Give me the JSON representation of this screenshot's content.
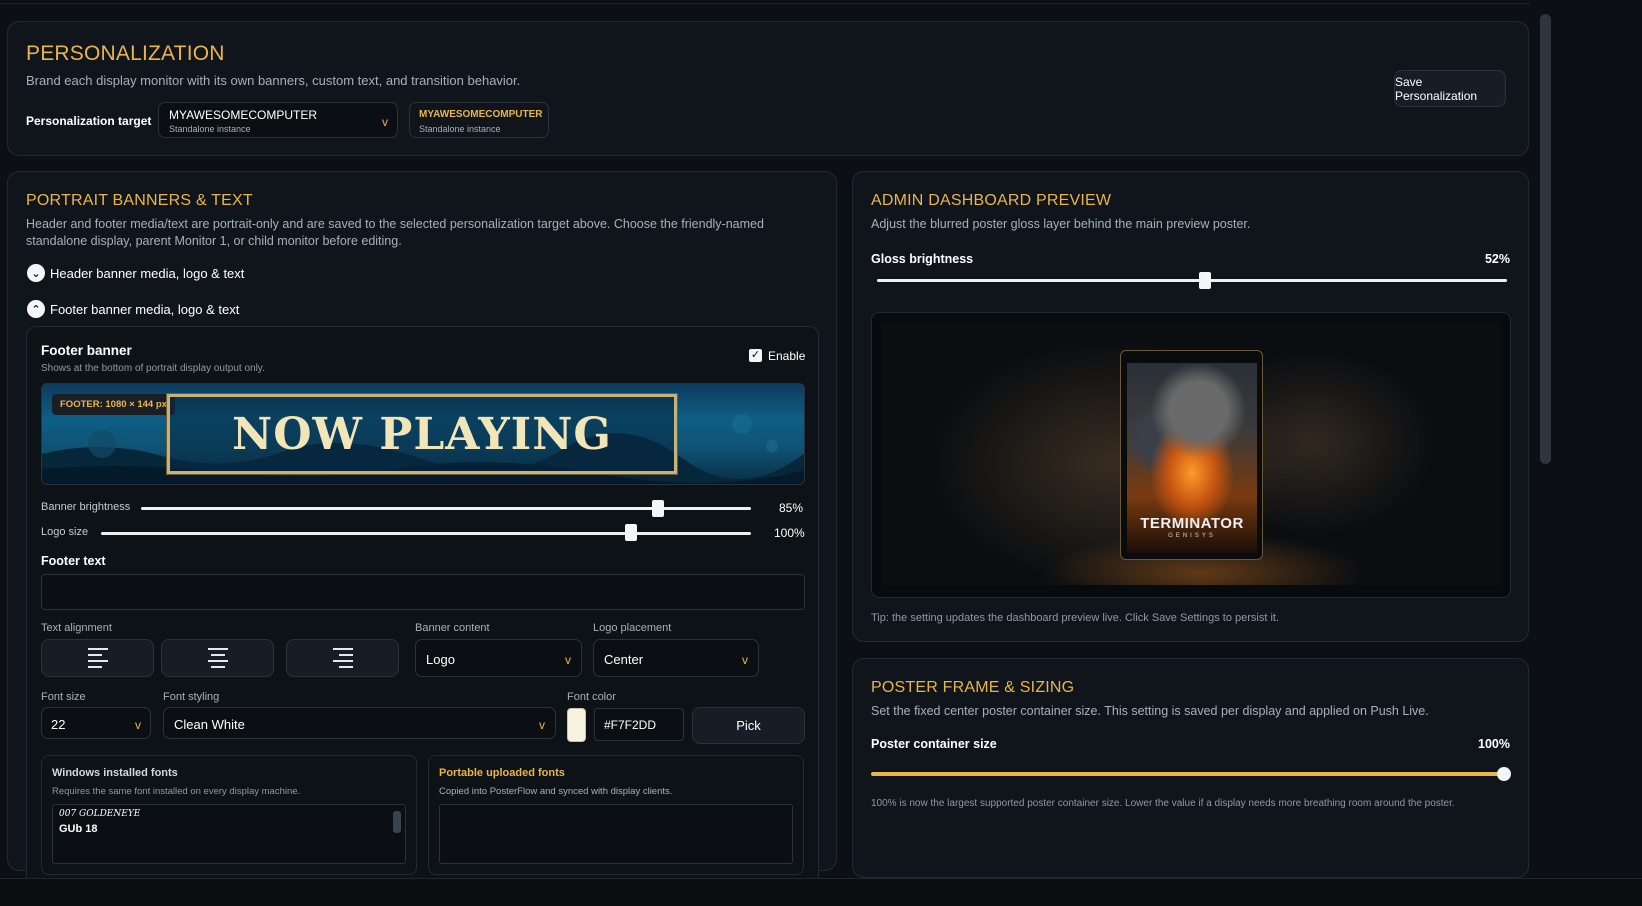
{
  "personalization": {
    "title": "PERSONALIZATION",
    "subtitle": "Brand each display monitor with its own banners, custom text, and transition behavior.",
    "target_label": "Personalization target",
    "target_select": {
      "name": "MYAWESOMECOMPUTER",
      "sub": "Standalone instance"
    },
    "target_chip": {
      "name": "MYAWESOMECOMPUTER",
      "sub": "Standalone instance"
    },
    "save_label": "Save Personalization"
  },
  "portrait": {
    "title": "PORTRAIT BANNERS & TEXT",
    "description": "Header and footer media/text are portrait-only and are saved to the selected personalization target above. Choose the friendly-named standalone display, parent Monitor 1, or child monitor before editing.",
    "header_toggle": "Header banner media, logo & text",
    "footer_toggle": "Footer banner media, logo & text",
    "footer": {
      "title": "Footer banner",
      "hint": "Shows at the bottom of portrait display output only.",
      "enable_label": "Enable",
      "enabled": true,
      "size_badge": "FOOTER: 1080 × 144 px",
      "banner_text": "NOW PLAYING",
      "brightness_label": "Banner brightness",
      "brightness_value": "85%",
      "brightness_level": 0.85,
      "logo_size_label": "Logo size",
      "logo_size_value": "100%",
      "logo_size_level": 0.8,
      "text_label": "Footer text",
      "text_value": "",
      "alignment_label": "Text alignment",
      "banner_content_label": "Banner content",
      "banner_content_value": "Logo",
      "logo_placement_label": "Logo placement",
      "logo_placement_value": "Center",
      "font_size_label": "Font size",
      "font_size_value": "22",
      "font_styling_label": "Font styling",
      "font_styling_value": "Clean White",
      "font_color_label": "Font color",
      "font_color_value": "#F7F2DD",
      "pick_label": "Pick",
      "windows_fonts_title": "Windows installed fonts",
      "windows_fonts_hint": "Requires the same font installed on every display machine.",
      "windows_fonts_items": [
        "007 GOLDENEYE",
        "GUb 18"
      ],
      "portable_fonts_title": "Portable uploaded fonts",
      "portable_fonts_hint": "Copied into PosterFlow and synced with display clients."
    }
  },
  "admin_preview": {
    "title": "ADMIN DASHBOARD PREVIEW",
    "subtitle": "Adjust the blurred poster gloss layer behind the main preview poster.",
    "gloss_label": "Gloss brightness",
    "gloss_value": "52%",
    "gloss_level": 0.52,
    "poster_title": "TERMINATOR",
    "poster_sub": "GENISYS",
    "tip": "Tip: the setting updates the dashboard preview live. Click Save Settings to persist it."
  },
  "poster_frame": {
    "title": "POSTER FRAME & SIZING",
    "subtitle": "Set the fixed center poster container size. This setting is saved per display and applied on Push Live.",
    "size_label": "Poster container size",
    "size_value": "100%",
    "size_level": 1.0,
    "note": "100% is now the largest supported poster container size. Lower the value if a display needs more breathing room around the poster."
  },
  "colors": {
    "accent": "#e9b44c",
    "background": "#0c1014",
    "card": "#10151b",
    "font_color_swatch": "#F7F2DD"
  }
}
